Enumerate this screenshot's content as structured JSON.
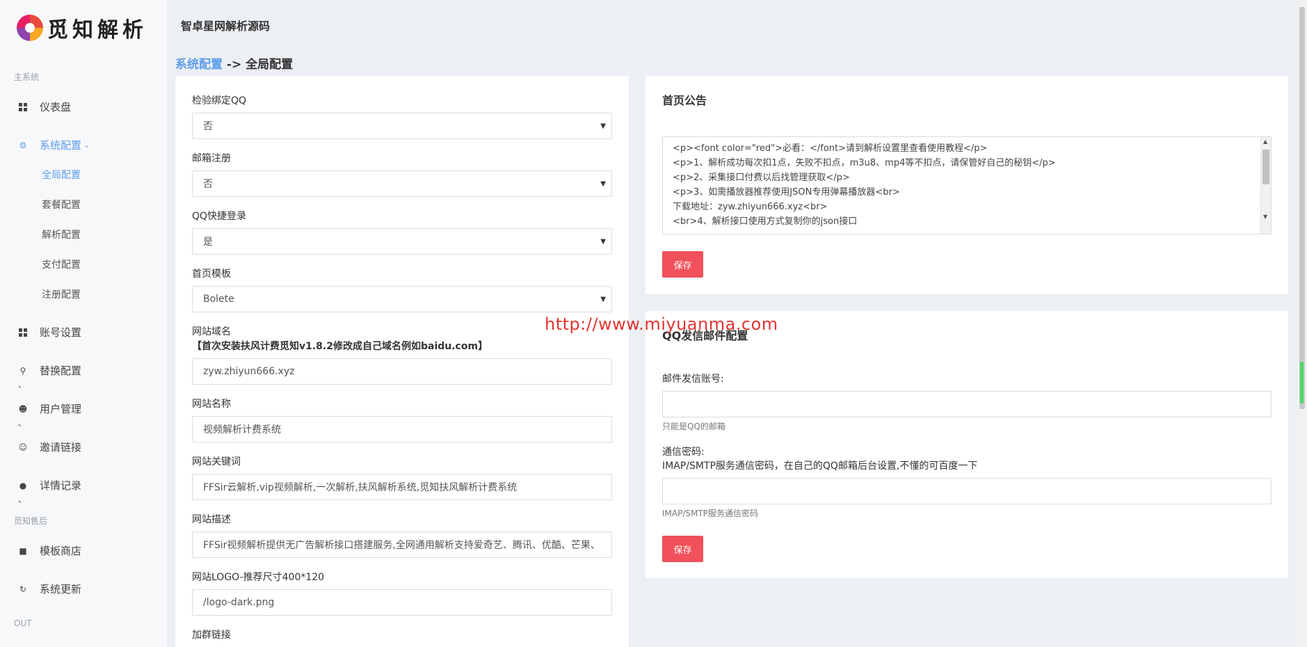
{
  "brand": {
    "logo_text": "觅知解析"
  },
  "header": {
    "site_title": "智卓星网解析源码"
  },
  "breadcrumb": {
    "link": "系统配置",
    "separator": " -> ",
    "current": "全局配置"
  },
  "sidebar": {
    "section_main": "主系统",
    "section_after": "觅知售后",
    "section_out": "OUT",
    "items": [
      {
        "label": "仪表盘",
        "icon": "dashboard-icon"
      },
      {
        "label": "系统配置",
        "icon": "settings-icon"
      },
      {
        "label": "账号设置",
        "icon": "dashboard-icon"
      },
      {
        "label": "替换配置",
        "icon": "search-icon"
      },
      {
        "label": "用户管理",
        "icon": "user-icon"
      },
      {
        "label": "邀请链接",
        "icon": "user-add-icon"
      },
      {
        "label": "详情记录",
        "icon": "dot-icon"
      },
      {
        "label": "模板商店",
        "icon": "bag-icon"
      },
      {
        "label": "系统更新",
        "icon": "refresh-icon"
      }
    ],
    "subitems": [
      "全局配置",
      "套餐配置",
      "解析配置",
      "支付配置",
      "注册配置"
    ],
    "tick": "、"
  },
  "global_form": {
    "check_qq_label": "检验绑定QQ",
    "check_qq_value": "否",
    "email_reg_label": "邮箱注册",
    "email_reg_value": "否",
    "qq_login_label": "QQ快捷登录",
    "qq_login_value": "是",
    "template_label": "首页模板",
    "template_value": "Bolete",
    "domain_label": "网站域名",
    "domain_note": "【首次安装扶风计费觅知v1.8.2修改成自己域名例如baidu.com】",
    "domain_value": "zyw.zhiyun666.xyz",
    "site_name_label": "网站名称",
    "site_name_value": "视频解析计费系统",
    "keywords_label": "网站关键词",
    "keywords_value": "FFSir云解析,vip视频解析,一次解析,扶风解析系统,觅知扶风解析计费系统",
    "desc_label": "网站描述",
    "desc_value": "FFSir视频解析提供无广告解析接口搭建服务,全网通用解析支持爱奇艺、腾讯、优酷、芒果、",
    "logo_label": "网站LOGO-推荐尺寸400*120",
    "logo_value": "/logo-dark.png",
    "group_label": "加群链接"
  },
  "notice_card": {
    "title": "首页公告",
    "lines": [
      "<p><font color=\"red\">必看：</font>请到解析设置里查看使用教程</p>",
      "<p>1、解析成功每次扣1点，失败不扣点，m3u8、mp4等不扣点，请保管好自己的秘钥</p>",
      "<p>2、采集接口付费以后找管理获取</p>",
      "<p>3、如需播放器推荐使用JSON专用弹幕播放器<br>",
      "下载地址：zyw.zhiyun666.xyz<br>",
      "<br>4、解析接口使用方式复制你的json接口"
    ],
    "save": "保存"
  },
  "mail_card": {
    "title": "QQ发信邮件配置",
    "account_label": "邮件发信账号:",
    "account_help": "只能是QQ的邮箱",
    "password_label": "通信密码:",
    "password_desc": "IMAP/SMTP服务通信密码，在自己的QQ邮箱后台设置,不懂的可百度一下",
    "password_help": "IMAP/SMTP服务通信密码",
    "save": "保存"
  },
  "watermark": "http://www.miyuanma.com",
  "colors": {
    "accent": "#5d9cec",
    "danger": "#f0515a",
    "watermark": "#e3342f"
  }
}
